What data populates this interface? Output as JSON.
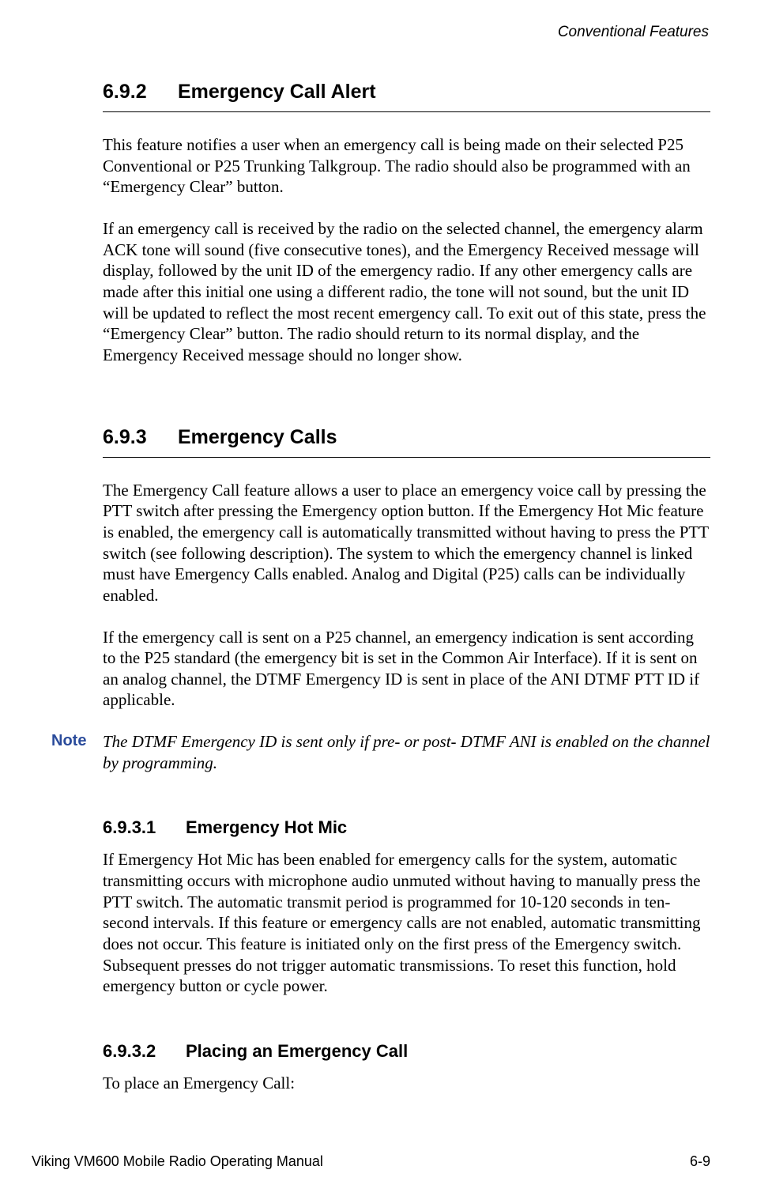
{
  "header": {
    "right": "Conventional Features"
  },
  "sections": {
    "s692": {
      "num": "6.9.2",
      "title": "Emergency Call Alert",
      "p1": "This feature notifies a user when an emergency call is being made on their selected P25 Conventional or P25 Trunking Talkgroup. The radio should also be programmed with an “Emergency Clear” button.",
      "p2": "If an emergency call is received by the radio on the selected channel, the emergency alarm ACK tone will sound (five consecutive tones), and the Emergency Received message will display, followed by the unit ID of the emergency radio. If any other emergency calls are made after this initial one using a different radio, the tone will not sound, but the unit ID will be updated to reflect the most recent emergency call. To exit out of this state, press the “Emergency Clear” button. The radio should return to its normal display, and the Emergency Received message should no longer show."
    },
    "s693": {
      "num": "6.9.3",
      "title": "Emergency Calls",
      "p1": "The Emergency Call feature allows a user to place an emergency voice call by pressing the PTT switch after pressing the Emergency option button. If the Emergency Hot Mic feature is enabled, the emergency call is automatically transmitted without having to press the PTT switch (see following description). The system to which the emergency channel is linked must have Emergency Calls enabled. Analog and Digital (P25) calls can be individually enabled.",
      "p2": "If the emergency call is sent on a P25 channel, an emergency indication is sent according to the P25 standard (the emergency bit is set in the Common Air Interface). If it is sent on an analog channel, the DTMF Emergency ID is sent in place of the ANI DTMF PTT ID if applicable.",
      "note_label": "Note",
      "note_text": "The DTMF Emergency ID is sent only if pre- or post- DTMF ANI is enabled on the channel by programming."
    },
    "s6931": {
      "num": "6.9.3.1",
      "title": "Emergency Hot Mic",
      "p1": "If Emergency Hot Mic has been enabled for emergency calls for the system, automatic transmitting occurs with microphone audio unmuted without having to manually press the PTT switch. The automatic transmit period is programmed for 10-120 seconds in ten-second intervals. If this feature or emergency calls are not enabled, automatic transmitting does not occur. This feature is initiated only on the first press of the Emergency switch. Subsequent presses do not trigger automatic transmissions. To reset this function, hold emergency button or cycle power."
    },
    "s6932": {
      "num": "6.9.3.2",
      "title": "Placing an Emergency Call",
      "p1": "To place an Emergency Call:"
    }
  },
  "footer": {
    "left": "Viking VM600 Mobile Radio Operating Manual",
    "right": "6-9"
  }
}
